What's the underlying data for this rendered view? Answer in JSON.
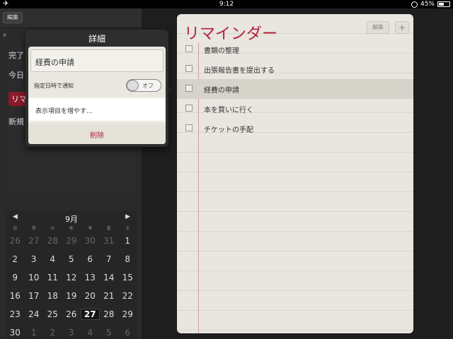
{
  "status_bar": {
    "time": "9:12",
    "battery": "45%",
    "battery_level": 0.45
  },
  "left": {
    "edit_label": "編集",
    "items": [
      "完了",
      "今日",
      "リマ",
      "新規"
    ],
    "active_index": 2
  },
  "calendar": {
    "month": "9月",
    "prev": "◀",
    "next": "▶",
    "weekdays": [
      "日",
      "月",
      "火",
      "水",
      "木",
      "金",
      "土"
    ],
    "weeks": [
      [
        "26",
        "27",
        "28",
        "29",
        "30",
        "31",
        "1"
      ],
      [
        "2",
        "3",
        "4",
        "5",
        "6",
        "7",
        "8"
      ],
      [
        "9",
        "10",
        "11",
        "12",
        "13",
        "14",
        "15"
      ],
      [
        "16",
        "17",
        "18",
        "19",
        "20",
        "21",
        "22"
      ],
      [
        "23",
        "24",
        "25",
        "26",
        "27",
        "28",
        "29"
      ],
      [
        "30",
        "1",
        "2",
        "3",
        "4",
        "5",
        "6"
      ]
    ],
    "today": "27"
  },
  "popover": {
    "title": "詳細",
    "task_name": "経費の申請",
    "notify_label": "指定日時で通知",
    "notify_toggle": "オフ",
    "show_more": "表示項目を増やす...",
    "delete": "削除"
  },
  "reminders": {
    "title": "リマインダー",
    "edit_label": "編集",
    "add_label": "+",
    "items": [
      {
        "text": "書類の整理",
        "checked": false
      },
      {
        "text": "出張報告書を提出する",
        "checked": false
      },
      {
        "text": "経費の申請",
        "checked": false,
        "selected": true
      },
      {
        "text": "本を買いに行く",
        "checked": false
      },
      {
        "text": "チケットの手配",
        "checked": false
      }
    ]
  },
  "colors": {
    "accent": "#b3223e",
    "paper": "#e8e6df"
  }
}
